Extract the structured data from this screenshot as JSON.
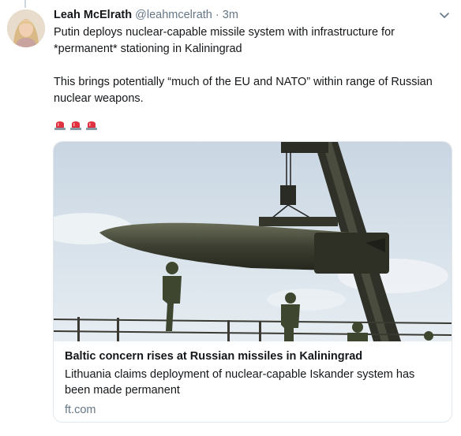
{
  "tweet": {
    "author_name": "Leah McElrath",
    "author_handle": "@leahmcelrath",
    "separator": "·",
    "time": "3m",
    "text_line_1": "Putin deploys nuclear-capable missile system with infrastructure for *permanent* stationing in Kaliningrad",
    "text_line_2": "This brings potentially “much of the EU and NATO” within range of Russian nuclear weapons.",
    "emojis": [
      "police-light-icon",
      "police-light-icon",
      "police-light-icon"
    ]
  },
  "card": {
    "title": "Baltic concern rises at Russian missiles in Kaliningrad",
    "description": "Lithuania claims deployment of nuclear-capable Iskander system has been made permanent",
    "domain": "ft.com"
  },
  "colors": {
    "text": "#14171a",
    "secondary": "#657786",
    "border": "#e1e8ed",
    "emoji_red": "#e0313f"
  }
}
